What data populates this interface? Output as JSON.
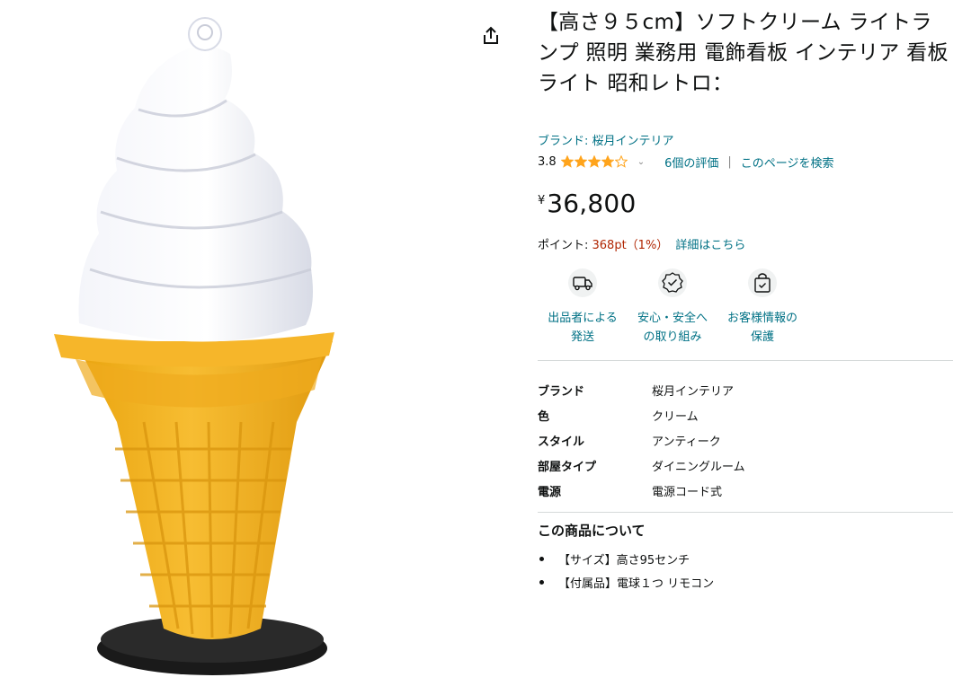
{
  "product": {
    "title": "【高さ９５cm】ソフトクリーム ライトランプ 照明 業務用 電飾看板 インテリア 看板ライト 昭和レトロ：",
    "brand_link": "ブランド: 桜月インテリア",
    "rating_value": "3.8",
    "rating_stars": 3.8,
    "ratings_count": "6個の評価",
    "search_page": "このページを検索",
    "separator": "|",
    "price_currency": "¥",
    "price_amount": "36,800",
    "points_label": "ポイント: ",
    "points_value": "368pt（1%）",
    "points_link": "詳細はこちら"
  },
  "features": [
    {
      "icon": "truck-icon",
      "line1": "出品者による",
      "line2": "発送"
    },
    {
      "icon": "badge-check-icon",
      "line1": "安心・安全へ",
      "line2": "の取り組み"
    },
    {
      "icon": "lock-bag-icon",
      "line1": "お客様情報の",
      "line2": "保護"
    }
  ],
  "specs": [
    {
      "key": "ブランド",
      "value": "桜月インテリア"
    },
    {
      "key": "色",
      "value": "クリーム"
    },
    {
      "key": "スタイル",
      "value": "アンティーク"
    },
    {
      "key": "部屋タイプ",
      "value": "ダイニングルーム"
    },
    {
      "key": "電源",
      "value": "電源コード式"
    }
  ],
  "about": {
    "heading": "この商品について",
    "bullets": [
      "【サイズ】高さ95センチ",
      "【付属品】電球１つ リモコン"
    ]
  },
  "colors": {
    "link": "#007185",
    "star": "#ffa41c",
    "points": "#b12704",
    "cone": "#f4b41c",
    "cream": "#eceef4"
  }
}
